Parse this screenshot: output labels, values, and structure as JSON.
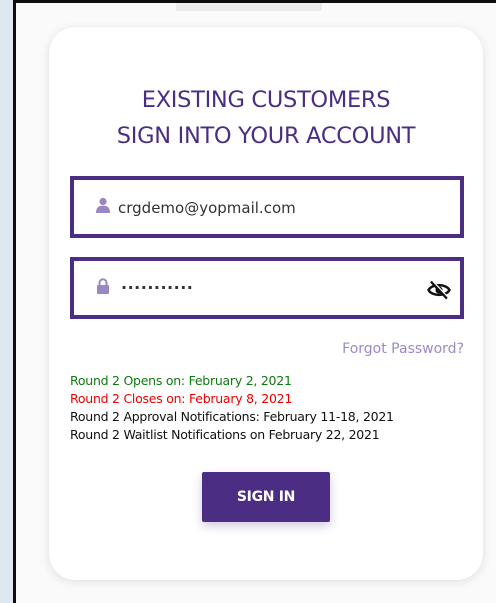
{
  "login": {
    "heading_line1": "EXISTING CUSTOMERS",
    "heading_line2": "SIGN INTO YOUR ACCOUNT",
    "email": {
      "value": "crgdemo@yopmail.com",
      "icon": "user-icon"
    },
    "password": {
      "value": "...........",
      "icon": "lock-icon",
      "toggle_icon": "eye-slash-icon"
    },
    "forgot_label": "Forgot Password?",
    "notices": [
      {
        "text": "Round 2 Opens on: February 2, 2021",
        "color": "#0f7a0f"
      },
      {
        "text": "Round 2 Closes on: February 8, 2021",
        "color": "#ee0000"
      },
      {
        "text": "Round 2 Approval Notifications: February 11-18, 2021",
        "color": "#111111"
      },
      {
        "text": "Round 2 Waitlist Notifications on February 22, 2021",
        "color": "#111111"
      }
    ],
    "signin_label": "SIGN IN"
  },
  "colors": {
    "brand": "#4b2d83",
    "link": "#9c89c7",
    "field_icon": "#9a86c4"
  }
}
